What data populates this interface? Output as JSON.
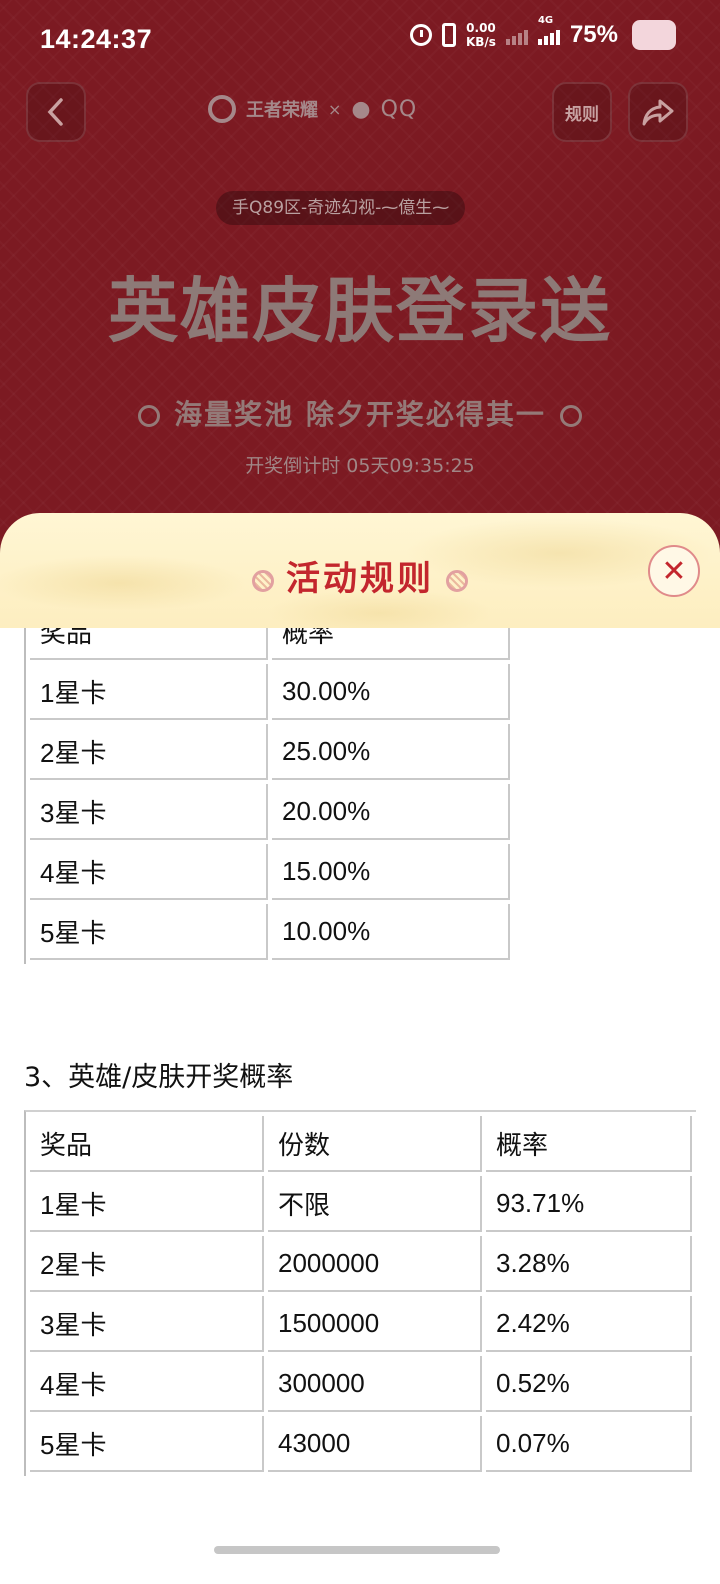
{
  "status": {
    "time": "14:24:37",
    "speed_value": "0.00",
    "speed_unit": "KB/s",
    "network": "4G",
    "battery": "75%"
  },
  "nav": {
    "rules_label": "规则"
  },
  "logos": {
    "brand": "王者荣耀",
    "separator": "×",
    "partner": "QQ"
  },
  "user_pill": "手Q89区-奇迹幻视-⁓億生⁓",
  "headline": "英雄皮肤登录送",
  "subline": "海量奖池 除夕开奖必得其一",
  "countdown": "开奖倒计时 05天09:35:25",
  "sheet": {
    "title": "活动规则",
    "close_icon": "close-icon"
  },
  "table1": {
    "headers": [
      "奖品",
      "概率"
    ],
    "rows": [
      [
        "1星卡",
        "30.00%"
      ],
      [
        "2星卡",
        "25.00%"
      ],
      [
        "3星卡",
        "20.00%"
      ],
      [
        "4星卡",
        "15.00%"
      ],
      [
        "5星卡",
        "10.00%"
      ]
    ]
  },
  "section3_title": "3、英雄/皮肤开奖概率",
  "table2": {
    "headers": [
      "奖品",
      "份数",
      "概率"
    ],
    "rows": [
      [
        "1星卡",
        "不限",
        "93.71%"
      ],
      [
        "2星卡",
        "2000000",
        "3.28%"
      ],
      [
        "3星卡",
        "1500000",
        "2.42%"
      ],
      [
        "4星卡",
        "300000",
        "0.52%"
      ],
      [
        "5星卡",
        "43000",
        "0.07%"
      ]
    ]
  }
}
